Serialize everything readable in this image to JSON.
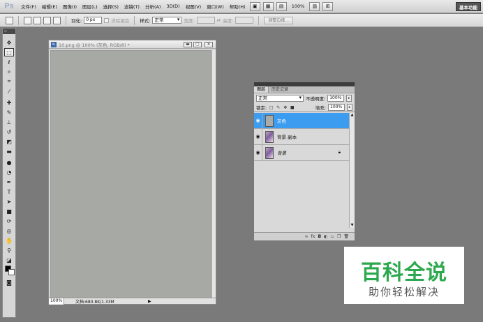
{
  "app": {
    "logo": "Ps"
  },
  "menubar": {
    "items": [
      "文件(F)",
      "编辑(E)",
      "图像(I)",
      "图层(L)",
      "选择(S)",
      "滤镜(T)",
      "分析(A)",
      "3D(D)",
      "视图(V)",
      "窗口(W)",
      "帮助(H)"
    ],
    "zoom": "100%",
    "workspace": "基本功能"
  },
  "options": {
    "feather_label": "羽化:",
    "feather_value": "0 px",
    "antialias_label": "消除锯齿",
    "style_label": "样式:",
    "style_value": "正常",
    "width_label": "宽度:",
    "height_label": "高度:",
    "refine_edge": "调整边缘..."
  },
  "document": {
    "title": "10.png @ 100% (灰色, RGB/8) *",
    "zoom": "100%",
    "doc_size": "文档:680.8K/1.33M",
    "canvas_color": "#a7a9a5"
  },
  "layers_panel": {
    "tabs": [
      "图层",
      "历史记录"
    ],
    "blend_mode": "正常",
    "opacity_label": "不透明度:",
    "opacity_value": "100%",
    "lock_label": "锁定:",
    "fill_label": "填充:",
    "fill_value": "100%",
    "layers": [
      {
        "name": "灰色",
        "selected": true
      },
      {
        "name": "背景 副本",
        "selected": false
      },
      {
        "name": "背景",
        "selected": false
      }
    ]
  },
  "watermark": {
    "title": "百科全说",
    "subtitle": "助你轻松解决"
  }
}
